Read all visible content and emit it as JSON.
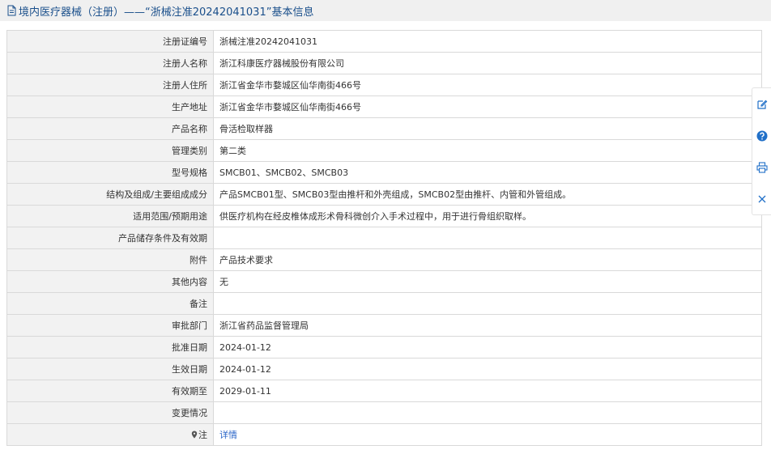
{
  "header": {
    "title": "境内医疗器械（注册）——“浙械注准20242041031”基本信息"
  },
  "rows": [
    {
      "label": "注册证编号",
      "value": "浙械注准20242041031"
    },
    {
      "label": "注册人名称",
      "value": "浙江科康医疗器械股份有限公司"
    },
    {
      "label": "注册人住所",
      "value": "浙江省金华市婺城区仙华南街466号"
    },
    {
      "label": "生产地址",
      "value": "浙江省金华市婺城区仙华南街466号"
    },
    {
      "label": "产品名称",
      "value": "骨活检取样器"
    },
    {
      "label": "管理类别",
      "value": "第二类"
    },
    {
      "label": "型号规格",
      "value": "SMCB01、SMCB02、SMCB03"
    },
    {
      "label": "结构及组成/主要组成成分",
      "value": "产品SMCB01型、SMCB03型由推杆和外壳组成，SMCB02型由推杆、内管和外管组成。"
    },
    {
      "label": "适用范围/预期用途",
      "value": "供医疗机构在经皮椎体成形术骨科微创介入手术过程中，用于进行骨组织取样。"
    },
    {
      "label": "产品储存条件及有效期",
      "value": ""
    },
    {
      "label": "附件",
      "value": "产品技术要求"
    },
    {
      "label": "其他内容",
      "value": "无"
    },
    {
      "label": "备注",
      "value": ""
    },
    {
      "label": "审批部门",
      "value": "浙江省药品监督管理局"
    },
    {
      "label": "批准日期",
      "value": "2024-01-12"
    },
    {
      "label": "生效日期",
      "value": "2024-01-12"
    },
    {
      "label": "有效期至",
      "value": "2029-01-11"
    },
    {
      "label": "变更情况",
      "value": ""
    }
  ],
  "note_row": {
    "label": "注",
    "link": "详情"
  },
  "toolbar": {
    "icons": [
      "edit-icon",
      "help-icon",
      "print-icon",
      "close-icon"
    ]
  },
  "colors": {
    "title_text": "#1a4f8b",
    "title_bg": "#f0f0f0",
    "label_bg": "#f2f2f2",
    "border": "#d9d9d9",
    "link": "#2b66c8",
    "help_icon": "#2170c8"
  }
}
